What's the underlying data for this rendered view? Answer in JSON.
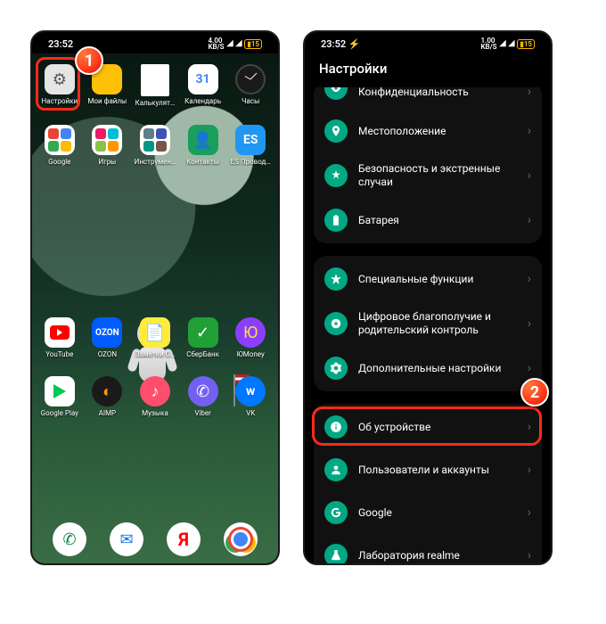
{
  "annotations": {
    "step1": "1",
    "step2": "2"
  },
  "statusbar": {
    "time1": "23:52",
    "time2": "23:52",
    "net_speed1": "4.00",
    "net_speed2": "1.00",
    "net_unit": "KB/S",
    "battery": "15"
  },
  "home": {
    "row1": [
      {
        "name": "settings",
        "label": "Настройки"
      },
      {
        "name": "files",
        "label": "Мои файлы"
      },
      {
        "name": "calculator",
        "label": "Калькулят…"
      },
      {
        "name": "calendar",
        "label": "Календарь",
        "num": "31"
      },
      {
        "name": "clock",
        "label": "Часы"
      }
    ],
    "row2": [
      {
        "name": "google-folder",
        "label": "Google"
      },
      {
        "name": "games-folder",
        "label": "Игры"
      },
      {
        "name": "tools-folder",
        "label": "Инструмен…"
      },
      {
        "name": "contacts",
        "label": "Контакты"
      },
      {
        "name": "es",
        "label": "ES Провод…",
        "text": "ES"
      }
    ],
    "row3": [
      {
        "name": "youtube",
        "label": "YouTube"
      },
      {
        "name": "ozon",
        "label": "OZON",
        "text": "OZON"
      },
      {
        "name": "notes",
        "label": "Заметки G…"
      },
      {
        "name": "sber",
        "label": "СберБанк"
      },
      {
        "name": "yoomoney",
        "label": "ЮMoney",
        "text": "Ю"
      }
    ],
    "row4": [
      {
        "name": "play",
        "label": "Google Play"
      },
      {
        "name": "aimp",
        "label": "AIMP"
      },
      {
        "name": "music",
        "label": "Музыка"
      },
      {
        "name": "viber",
        "label": "Viber"
      },
      {
        "name": "vk",
        "label": "VK",
        "text": "w"
      }
    ],
    "dock": [
      {
        "name": "phone"
      },
      {
        "name": "messages"
      },
      {
        "name": "yandex",
        "text": "Я"
      },
      {
        "name": "chrome"
      }
    ]
  },
  "settings": {
    "title": "Настройки",
    "group1": [
      {
        "name": "privacy",
        "label": "Конфиденциальность",
        "icon": "eye"
      },
      {
        "name": "location",
        "label": "Местоположение",
        "icon": "pin"
      },
      {
        "name": "security",
        "label": "Безопасность и экстренные случаи",
        "icon": "asterisk"
      },
      {
        "name": "battery",
        "label": "Батарея",
        "icon": "battery"
      }
    ],
    "group2": [
      {
        "name": "special",
        "label": "Специальные функции",
        "icon": "star"
      },
      {
        "name": "wellbeing",
        "label": "Цифровое благополучие и родительский контроль",
        "icon": "wellbeing"
      },
      {
        "name": "additional",
        "label": "Дополнительные настройки",
        "icon": "gear"
      }
    ],
    "group3": [
      {
        "name": "about",
        "label": "Об устройстве",
        "icon": "info"
      },
      {
        "name": "users",
        "label": "Пользователи и аккаунты",
        "icon": "user"
      },
      {
        "name": "google",
        "label": "Google",
        "icon": "g"
      },
      {
        "name": "lab",
        "label": "Лаборатория realme",
        "icon": "flask"
      }
    ]
  }
}
